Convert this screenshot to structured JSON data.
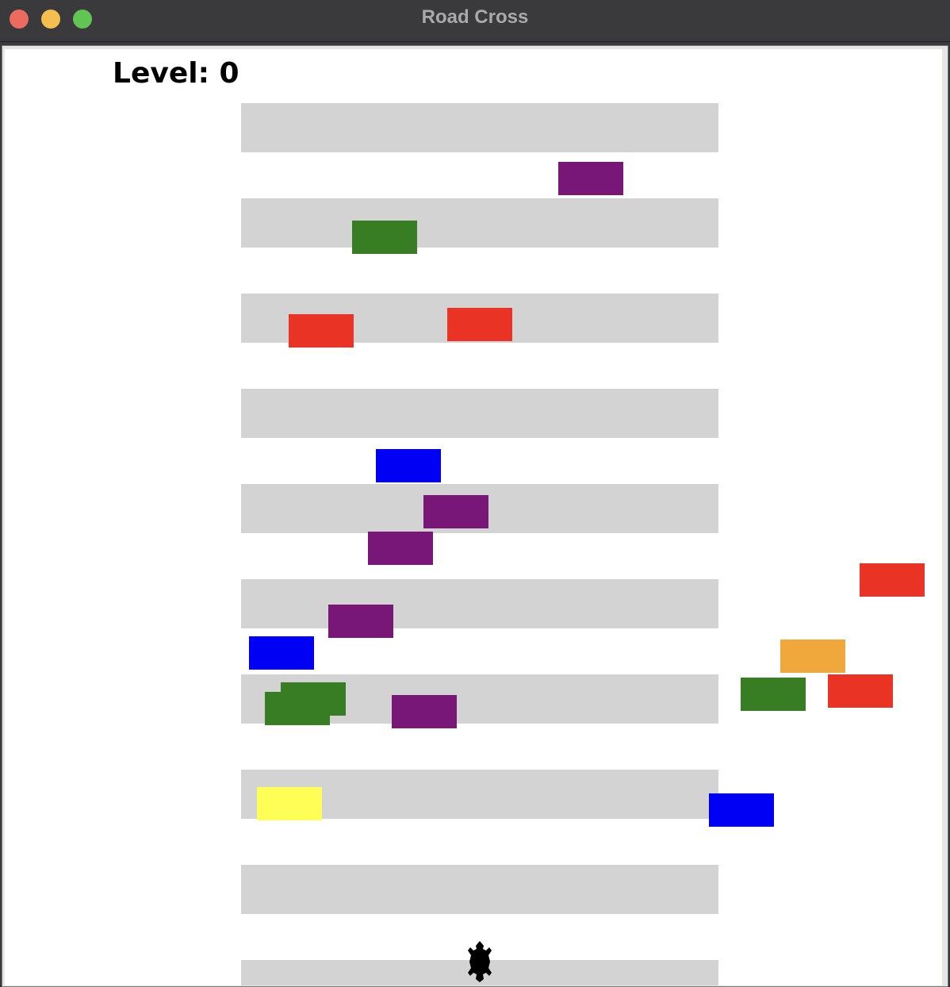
{
  "window": {
    "title": "Road Cross"
  },
  "hud": {
    "level_text": "Level: 0"
  },
  "colors": {
    "lane": "#d3d3d3",
    "background": "#ffffff",
    "purple": "#791779",
    "green": "#387d23",
    "red": "#e93325",
    "blue": "#0000f5",
    "orange": "#f0a83d",
    "yellow": "#fefe56",
    "player": "#000000"
  },
  "player": {
    "icon": "turtle-icon"
  }
}
